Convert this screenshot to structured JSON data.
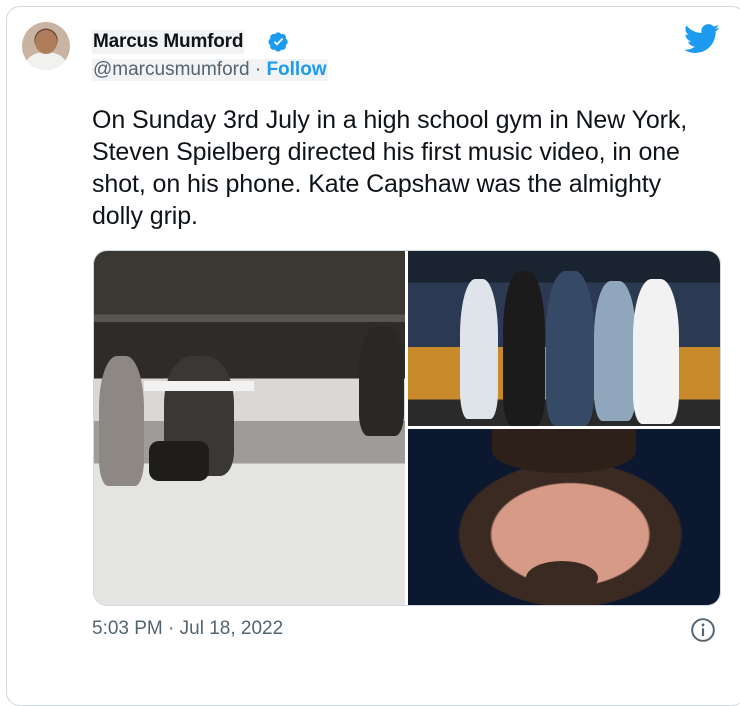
{
  "author": {
    "display_name": "Marcus Mumford",
    "handle": "@marcusmumford",
    "separator": "·",
    "follow_label": "Follow"
  },
  "tweet": {
    "text": "On Sunday 3rd July in a high school gym in New York, Steven Spielberg directed his first music video, in one shot, on his phone. Kate Capshaw was the almighty dolly grip.",
    "timestamp": "5:03 PM · Jul 18, 2022"
  },
  "icons": {
    "verified": "verified-badge-icon",
    "platform": "twitter-bird-icon",
    "info": "info-icon"
  },
  "colors": {
    "accent": "#1d9bf0",
    "text": "#0f1419",
    "muted": "#536471",
    "border": "#cfd9de"
  }
}
